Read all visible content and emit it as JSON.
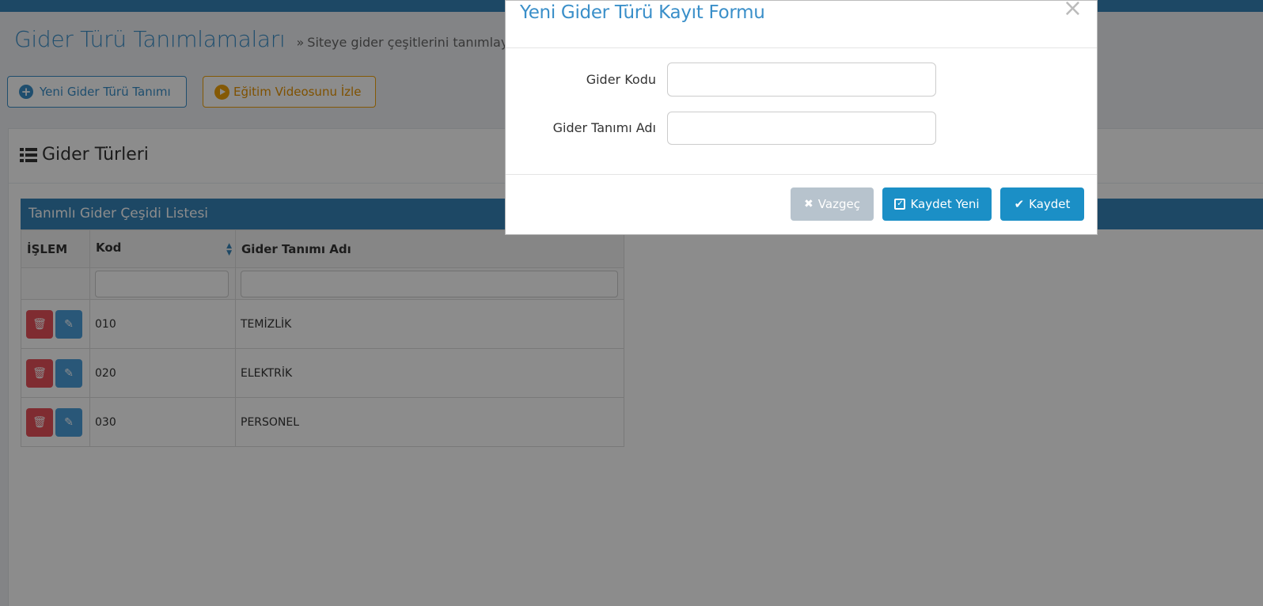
{
  "page": {
    "title": "Gider Türü Tanımlamaları",
    "subtitle": "Siteye gider çeşitlerini tanımlayabil",
    "subtitle_chevron": "»",
    "new_button_label": "Yeni Gider Türü Tanımı",
    "video_button_label": "Eğitim Videosunu İzle"
  },
  "portlet": {
    "title": "Gider Türleri",
    "list_title": "Tanımlı Gider Çeşidi Listesi"
  },
  "table": {
    "columns": [
      "İŞLEM",
      "Kod",
      "Gider Tanımı Adı"
    ],
    "rows": [
      {
        "kod": "010",
        "ad": "TEMİZLİK"
      },
      {
        "kod": "020",
        "ad": "ELEKTRİK"
      },
      {
        "kod": "030",
        "ad": "PERSONEL"
      }
    ]
  },
  "modal": {
    "title": "Yeni Gider Türü Kayıt Formu",
    "close_glyph": "×",
    "fields": {
      "kod_label": "Gider Kodu",
      "kod_value": "",
      "ad_label": "Gider Tanımı Adı",
      "ad_value": ""
    },
    "buttons": {
      "cancel": "Vazgeç",
      "save_new": "Kaydet Yeni",
      "save": "Kaydet"
    }
  },
  "colors": {
    "accent": "#3583b9",
    "title_blue": "#3a8fc9",
    "warning": "#f0a30a",
    "danger": "#e7505a",
    "primary_button": "#1b8fc6",
    "cancel_button": "#b7c3cd"
  }
}
